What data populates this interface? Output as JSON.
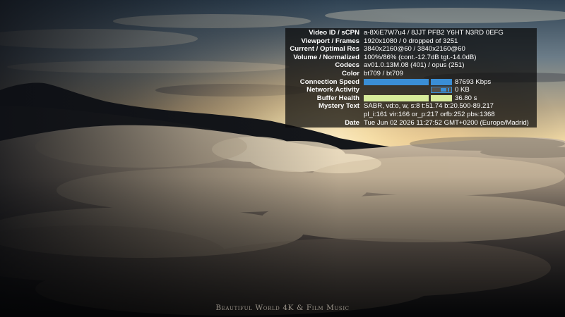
{
  "overlay": {
    "watermark": "Beautiful World 4K & Film Music"
  },
  "stats": {
    "rows": {
      "video_id": {
        "label": "Video ID / sCPN",
        "value": "a-8XiE7W7u4 / 8JJT PFB2 Y6HT N3RD 0EFG"
      },
      "viewport": {
        "label": "Viewport / Frames",
        "value": "1920x1080 / 0 dropped of 3251"
      },
      "resolution": {
        "label": "Current / Optimal Res",
        "value": "3840x2160@60 / 3840x2160@60"
      },
      "volume": {
        "label": "Volume / Normalized",
        "value": "100%/86% (cont.-12.7dB tgt.-14.0dB)"
      },
      "codecs": {
        "label": "Codecs",
        "value": "av01.0.13M.08 (401) / opus (251)"
      },
      "color": {
        "label": "Color",
        "value": "bt709 / bt709"
      },
      "connection_speed": {
        "label": "Connection Speed",
        "value": "87693 Kbps"
      },
      "network_activity": {
        "label": "Network Activity",
        "value": "0 KB"
      },
      "buffer_health": {
        "label": "Buffer Health",
        "value": "36.80 s"
      },
      "mystery_text": {
        "label": "Mystery Text",
        "value": "SABR, vd:o, w, s:8 t:51.74 b:20.500-89.217",
        "value2": "pl_i:161 vir:166 or_p:217 orfb:252 pbs:1368"
      },
      "date": {
        "label": "Date",
        "value": "Tue Jun 02 2026 11:27:52 GMT+0200 (Europe/Madrid)"
      }
    },
    "colors": {
      "connection_bar": "#3a8ed5",
      "buffer_bar": "#d8ec9a",
      "panel_background": "rgba(10,10,10,0.72)"
    }
  }
}
